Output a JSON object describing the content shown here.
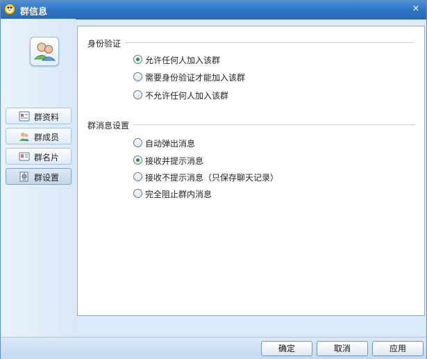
{
  "window": {
    "title": "群信息",
    "close_glyph": "×"
  },
  "sidebar": {
    "avatar_icon": "group-users-icon",
    "items": [
      {
        "label": "群资料",
        "icon": "group-info-icon",
        "selected": false
      },
      {
        "label": "群成员",
        "icon": "group-members-icon",
        "selected": false
      },
      {
        "label": "群名片",
        "icon": "group-card-icon",
        "selected": false
      },
      {
        "label": "群设置",
        "icon": "group-settings-icon",
        "selected": true
      }
    ]
  },
  "identity": {
    "title": "身份验证",
    "options": [
      {
        "label": "允许任何人加入该群",
        "checked": true
      },
      {
        "label": "需要身份验证才能加入该群",
        "checked": false
      },
      {
        "label": "不允许任何人加入该群",
        "checked": false
      }
    ]
  },
  "messages": {
    "title": "群消息设置",
    "options": [
      {
        "label": "自动弹出消息",
        "checked": false
      },
      {
        "label": "接收并提示消息",
        "checked": true
      },
      {
        "label": "接收不提示消息（只保存聊天记录）",
        "checked": false
      },
      {
        "label": "完全阻止群内消息",
        "checked": false
      }
    ]
  },
  "footer": {
    "ok_label": "确定",
    "cancel_label": "取消",
    "apply_label": "应用"
  },
  "colors": {
    "titlebar": "#2f74c4",
    "radio_selected": "#3c8a2d"
  }
}
